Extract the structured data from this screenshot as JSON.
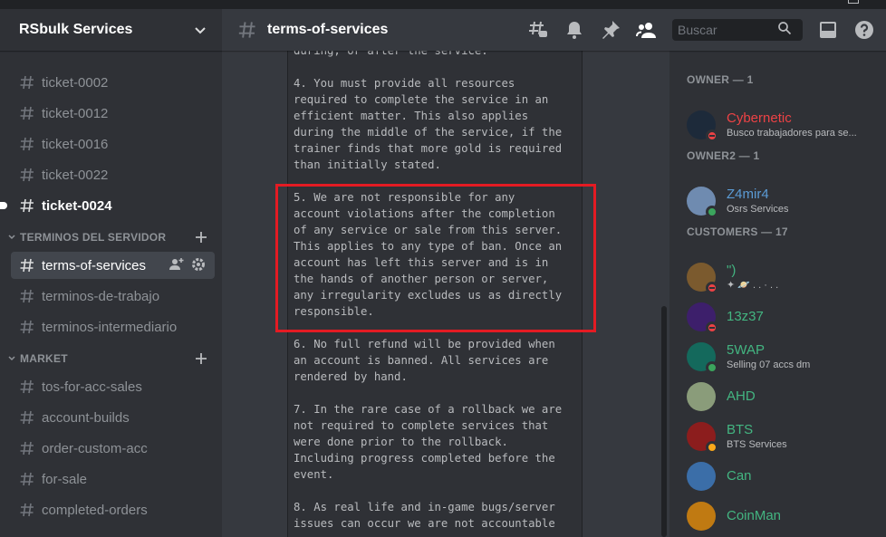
{
  "server": {
    "name": "RSbulk Services"
  },
  "channels_top": [
    {
      "label": "ticket-0002"
    },
    {
      "label": "ticket-0012"
    },
    {
      "label": "ticket-0016"
    },
    {
      "label": "ticket-0022"
    },
    {
      "label": "ticket-0024"
    }
  ],
  "category_terms": {
    "name": "TERMINOS DEL SERVIDOR",
    "channels": [
      {
        "label": "terms-of-services"
      },
      {
        "label": "terminos-de-trabajo"
      },
      {
        "label": "terminos-intermediario"
      }
    ]
  },
  "category_market": {
    "name": "MARKET",
    "channels": [
      {
        "label": "tos-for-acc-sales"
      },
      {
        "label": "account-builds"
      },
      {
        "label": "order-custom-acc"
      },
      {
        "label": "for-sale"
      },
      {
        "label": "completed-orders"
      }
    ]
  },
  "header": {
    "channel": "terms-of-services",
    "search_placeholder": "Buscar"
  },
  "message": {
    "lines": [
      "during, or after the service.",
      "",
      "4. You must provide all resources",
      "required to complete the service in an",
      "efficient matter. This also applies",
      "during the middle of the service, if the",
      "trainer finds that more gold is required",
      "than initially stated.",
      "",
      "5. We are not responsible for any",
      "account violations after the completion",
      "of any service or sale from this server.",
      "This applies to any type of ban. Once an",
      "account has left this server and is in",
      "the hands of another person or server,",
      "any irregularity excludes us as directly",
      "responsible.",
      "",
      "6. No full refund will be provided when",
      "an account is banned. All services are",
      "rendered by hand.",
      "",
      "7. In the rare case of a rollback we are",
      "not required to complete services that",
      "were done prior to the rollback.",
      "Including progress completed before the",
      "event.",
      "",
      "8. As real life and in-game bugs/server",
      "issues can occur we are not accountable"
    ]
  },
  "members": {
    "owner": {
      "header": "OWNER — 1",
      "list": [
        {
          "name": "Cybernetic",
          "activity": "Busco trabajadores para se...",
          "color": "#ed4245",
          "status": "dnd",
          "avatar": "#1d2a3a"
        }
      ]
    },
    "owner2": {
      "header": "OWNER2 — 1",
      "list": [
        {
          "name": "Z4mir4",
          "activity": "Osrs Services",
          "color": "#5b9bd5",
          "status": "online",
          "avatar": "#6f8bb0"
        }
      ]
    },
    "customers": {
      "header": "CUSTOMERS — 17",
      "list": [
        {
          "name": "\")",
          "activity": "✦  🪐  .  .  ·  .  .",
          "color": "#43b581",
          "status": "dnd",
          "avatar": "#7b5a2e"
        },
        {
          "name": "13z37",
          "activity": "",
          "color": "#43b581",
          "status": "dnd",
          "avatar": "#3d1f6b"
        },
        {
          "name": "5WAP",
          "activity": "Selling 07 accs dm",
          "color": "#43b581",
          "status": "online",
          "avatar": "#14695c"
        },
        {
          "name": "AHD",
          "activity": "",
          "color": "#43b581",
          "status": "none",
          "avatar": "#8a9c7a"
        },
        {
          "name": "BTS",
          "activity": "BTS Services",
          "color": "#43b581",
          "status": "idle",
          "avatar": "#8c1d1d"
        },
        {
          "name": "Can",
          "activity": "",
          "color": "#43b581",
          "status": "none",
          "avatar": "#3b6ea8"
        },
        {
          "name": "CoinMan",
          "activity": "",
          "color": "#43b581",
          "status": "none",
          "avatar": "#c07a12"
        }
      ]
    }
  },
  "icons": {
    "hash": "hash-icon",
    "threads": "threads-icon",
    "bell": "bell-icon",
    "pin": "pin-icon",
    "members": "members-icon",
    "inbox": "inbox-icon",
    "help": "help-icon",
    "search": "search-icon"
  },
  "colors": {
    "highlight": "#e41b23",
    "bg": "#36393f",
    "sidebar": "#2f3136"
  }
}
